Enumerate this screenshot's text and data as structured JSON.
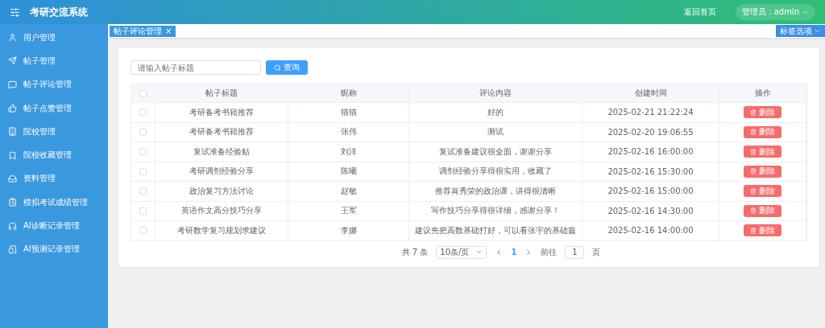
{
  "header": {
    "title": "考研交流系统",
    "home_link": "返回首页",
    "user": "管理员：admin"
  },
  "sidebar": {
    "items": [
      {
        "label": "用户管理"
      },
      {
        "label": "帖子管理"
      },
      {
        "label": "帖子评论管理"
      },
      {
        "label": "帖子点赞管理"
      },
      {
        "label": "院校管理"
      },
      {
        "label": "院校收藏管理"
      },
      {
        "label": "资料管理"
      },
      {
        "label": "模拟考试成绩管理"
      },
      {
        "label": "AI诊断记录管理"
      },
      {
        "label": "AI预测记录管理"
      }
    ]
  },
  "tabs": [
    {
      "label": "帖子评论管理",
      "close": "×",
      "selected": true
    }
  ],
  "tab_options": "标签选项",
  "search": {
    "placeholder": "请输入帖子标题",
    "button": "查询"
  },
  "table": {
    "select_all_checked": false,
    "columns": [
      "帖子标题",
      "昵称",
      "评论内容",
      "创建时间",
      "操作"
    ],
    "rows": [
      {
        "checked": false,
        "title": "考研备考书籍推荐",
        "nickname": "猫猫",
        "content": "好的",
        "created": "2025-02-21 21:22:24",
        "action": "删除"
      },
      {
        "checked": false,
        "title": "考研备考书籍推荐",
        "nickname": "张伟",
        "content": "测试",
        "created": "2025-02-20 19:06:55",
        "action": "删除"
      },
      {
        "checked": false,
        "title": "复试准备经验贴",
        "nickname": "刘洋",
        "content": "复试准备建议很全面，谢谢分享",
        "created": "2025-02-16 16:00:00",
        "action": "删除"
      },
      {
        "checked": false,
        "title": "考研调剂经验分享",
        "nickname": "陈曦",
        "content": "调剂经验分享得很实用，收藏了",
        "created": "2025-02-16 15:30:00",
        "action": "删除"
      },
      {
        "checked": false,
        "title": "政治复习方法讨论",
        "nickname": "赵敏",
        "content": "推荐肖秀荣的政治课，讲得很清晰",
        "created": "2025-02-16 15:00:00",
        "action": "删除"
      },
      {
        "checked": false,
        "title": "英语作文高分技巧分享",
        "nickname": "王军",
        "content": "写作技巧分享得很详细，感谢分享！",
        "created": "2025-02-16 14:30:00",
        "action": "删除"
      },
      {
        "checked": false,
        "title": "考研数学复习规划求建议",
        "nickname": "李娜",
        "content": "建议先把高数基础打好，可以看张宇的基础篇",
        "created": "2025-02-16 14:00:00",
        "action": "删除"
      }
    ]
  },
  "pagination": {
    "total": "共 7 条",
    "page_size": "10条/页",
    "pages": [
      {
        "label": "1",
        "selected": true
      }
    ],
    "goto_label": "前往",
    "goto_value": "1",
    "goto_suffix": "页"
  }
}
